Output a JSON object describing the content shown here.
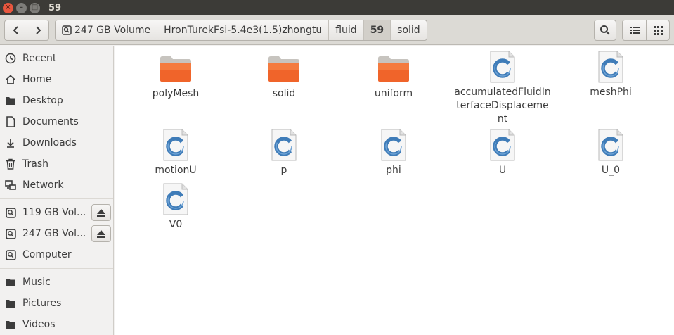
{
  "window": {
    "title": "59",
    "close_glyph": "×",
    "minimize_glyph": "–",
    "maximize_glyph": "□"
  },
  "toolbar": {
    "back_glyph": "‹",
    "forward_glyph": "›",
    "breadcrumbs": [
      {
        "label": "247 GB Volume",
        "icon": "drive-icon"
      },
      {
        "label": "HronTurekFsi-5.4e3(1.5)zhongtu"
      },
      {
        "label": "fluid"
      },
      {
        "label": "59",
        "active": true
      },
      {
        "label": "solid"
      }
    ]
  },
  "sidebar": {
    "items": [
      {
        "label": "Recent",
        "icon": "clock-icon"
      },
      {
        "label": "Home",
        "icon": "home-icon"
      },
      {
        "label": "Desktop",
        "icon": "folder-icon"
      },
      {
        "label": "Documents",
        "icon": "document-icon"
      },
      {
        "label": "Downloads",
        "icon": "download-icon"
      },
      {
        "label": "Trash",
        "icon": "trash-icon"
      },
      {
        "label": "Network",
        "icon": "network-icon"
      },
      {
        "label": "119 GB Vol...",
        "icon": "drive-icon",
        "eject": true
      },
      {
        "label": "247 GB Vol...",
        "icon": "drive-icon",
        "eject": true
      },
      {
        "label": "Computer",
        "icon": "drive-icon"
      },
      {
        "label": "Music",
        "icon": "folder-icon"
      },
      {
        "label": "Pictures",
        "icon": "folder-icon"
      },
      {
        "label": "Videos",
        "icon": "folder-icon"
      }
    ]
  },
  "files": [
    {
      "name": "polyMesh",
      "type": "folder"
    },
    {
      "name": "solid",
      "type": "folder"
    },
    {
      "name": "uniform",
      "type": "folder"
    },
    {
      "name": "accumulatedFluidInterfaceDisplacement",
      "type": "c-source"
    },
    {
      "name": "meshPhi",
      "type": "c-source"
    },
    {
      "name": "motionU",
      "type": "c-source"
    },
    {
      "name": "p",
      "type": "c-source"
    },
    {
      "name": "phi",
      "type": "c-source"
    },
    {
      "name": "U",
      "type": "c-source"
    },
    {
      "name": "U_0",
      "type": "c-source"
    },
    {
      "name": "V0",
      "type": "c-source"
    }
  ],
  "colors": {
    "folder": "#f0642a",
    "accent": "#dd4814",
    "c_file_ring": "#3f7cb8"
  }
}
